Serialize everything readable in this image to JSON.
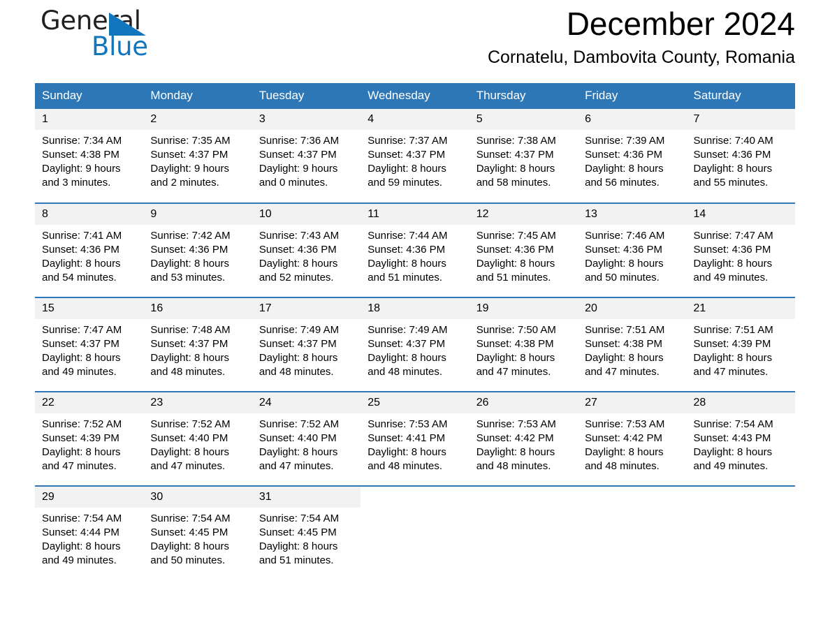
{
  "brand": {
    "word_one": "General",
    "word_two": "Blue",
    "triangle_color": "#1276bd",
    "text_color": "#231f20"
  },
  "header": {
    "title": "December 2024",
    "subtitle": "Cornatelu, Dambovita County, Romania"
  },
  "theme": {
    "header_bg": "#2e77b6",
    "header_text": "#ffffff",
    "daynum_bg": "#f2f2f2",
    "cell_bg": "#ffffff",
    "row_divider": "#2e77b6"
  },
  "weekday_headers": [
    "Sunday",
    "Monday",
    "Tuesday",
    "Wednesday",
    "Thursday",
    "Friday",
    "Saturday"
  ],
  "weeks": [
    [
      {
        "day": "1",
        "sunrise": "Sunrise: 7:34 AM",
        "sunset": "Sunset: 4:38 PM",
        "daylight1": "Daylight: 9 hours",
        "daylight2": "and 3 minutes."
      },
      {
        "day": "2",
        "sunrise": "Sunrise: 7:35 AM",
        "sunset": "Sunset: 4:37 PM",
        "daylight1": "Daylight: 9 hours",
        "daylight2": "and 2 minutes."
      },
      {
        "day": "3",
        "sunrise": "Sunrise: 7:36 AM",
        "sunset": "Sunset: 4:37 PM",
        "daylight1": "Daylight: 9 hours",
        "daylight2": "and 0 minutes."
      },
      {
        "day": "4",
        "sunrise": "Sunrise: 7:37 AM",
        "sunset": "Sunset: 4:37 PM",
        "daylight1": "Daylight: 8 hours",
        "daylight2": "and 59 minutes."
      },
      {
        "day": "5",
        "sunrise": "Sunrise: 7:38 AM",
        "sunset": "Sunset: 4:37 PM",
        "daylight1": "Daylight: 8 hours",
        "daylight2": "and 58 minutes."
      },
      {
        "day": "6",
        "sunrise": "Sunrise: 7:39 AM",
        "sunset": "Sunset: 4:36 PM",
        "daylight1": "Daylight: 8 hours",
        "daylight2": "and 56 minutes."
      },
      {
        "day": "7",
        "sunrise": "Sunrise: 7:40 AM",
        "sunset": "Sunset: 4:36 PM",
        "daylight1": "Daylight: 8 hours",
        "daylight2": "and 55 minutes."
      }
    ],
    [
      {
        "day": "8",
        "sunrise": "Sunrise: 7:41 AM",
        "sunset": "Sunset: 4:36 PM",
        "daylight1": "Daylight: 8 hours",
        "daylight2": "and 54 minutes."
      },
      {
        "day": "9",
        "sunrise": "Sunrise: 7:42 AM",
        "sunset": "Sunset: 4:36 PM",
        "daylight1": "Daylight: 8 hours",
        "daylight2": "and 53 minutes."
      },
      {
        "day": "10",
        "sunrise": "Sunrise: 7:43 AM",
        "sunset": "Sunset: 4:36 PM",
        "daylight1": "Daylight: 8 hours",
        "daylight2": "and 52 minutes."
      },
      {
        "day": "11",
        "sunrise": "Sunrise: 7:44 AM",
        "sunset": "Sunset: 4:36 PM",
        "daylight1": "Daylight: 8 hours",
        "daylight2": "and 51 minutes."
      },
      {
        "day": "12",
        "sunrise": "Sunrise: 7:45 AM",
        "sunset": "Sunset: 4:36 PM",
        "daylight1": "Daylight: 8 hours",
        "daylight2": "and 51 minutes."
      },
      {
        "day": "13",
        "sunrise": "Sunrise: 7:46 AM",
        "sunset": "Sunset: 4:36 PM",
        "daylight1": "Daylight: 8 hours",
        "daylight2": "and 50 minutes."
      },
      {
        "day": "14",
        "sunrise": "Sunrise: 7:47 AM",
        "sunset": "Sunset: 4:36 PM",
        "daylight1": "Daylight: 8 hours",
        "daylight2": "and 49 minutes."
      }
    ],
    [
      {
        "day": "15",
        "sunrise": "Sunrise: 7:47 AM",
        "sunset": "Sunset: 4:37 PM",
        "daylight1": "Daylight: 8 hours",
        "daylight2": "and 49 minutes."
      },
      {
        "day": "16",
        "sunrise": "Sunrise: 7:48 AM",
        "sunset": "Sunset: 4:37 PM",
        "daylight1": "Daylight: 8 hours",
        "daylight2": "and 48 minutes."
      },
      {
        "day": "17",
        "sunrise": "Sunrise: 7:49 AM",
        "sunset": "Sunset: 4:37 PM",
        "daylight1": "Daylight: 8 hours",
        "daylight2": "and 48 minutes."
      },
      {
        "day": "18",
        "sunrise": "Sunrise: 7:49 AM",
        "sunset": "Sunset: 4:37 PM",
        "daylight1": "Daylight: 8 hours",
        "daylight2": "and 48 minutes."
      },
      {
        "day": "19",
        "sunrise": "Sunrise: 7:50 AM",
        "sunset": "Sunset: 4:38 PM",
        "daylight1": "Daylight: 8 hours",
        "daylight2": "and 47 minutes."
      },
      {
        "day": "20",
        "sunrise": "Sunrise: 7:51 AM",
        "sunset": "Sunset: 4:38 PM",
        "daylight1": "Daylight: 8 hours",
        "daylight2": "and 47 minutes."
      },
      {
        "day": "21",
        "sunrise": "Sunrise: 7:51 AM",
        "sunset": "Sunset: 4:39 PM",
        "daylight1": "Daylight: 8 hours",
        "daylight2": "and 47 minutes."
      }
    ],
    [
      {
        "day": "22",
        "sunrise": "Sunrise: 7:52 AM",
        "sunset": "Sunset: 4:39 PM",
        "daylight1": "Daylight: 8 hours",
        "daylight2": "and 47 minutes."
      },
      {
        "day": "23",
        "sunrise": "Sunrise: 7:52 AM",
        "sunset": "Sunset: 4:40 PM",
        "daylight1": "Daylight: 8 hours",
        "daylight2": "and 47 minutes."
      },
      {
        "day": "24",
        "sunrise": "Sunrise: 7:52 AM",
        "sunset": "Sunset: 4:40 PM",
        "daylight1": "Daylight: 8 hours",
        "daylight2": "and 47 minutes."
      },
      {
        "day": "25",
        "sunrise": "Sunrise: 7:53 AM",
        "sunset": "Sunset: 4:41 PM",
        "daylight1": "Daylight: 8 hours",
        "daylight2": "and 48 minutes."
      },
      {
        "day": "26",
        "sunrise": "Sunrise: 7:53 AM",
        "sunset": "Sunset: 4:42 PM",
        "daylight1": "Daylight: 8 hours",
        "daylight2": "and 48 minutes."
      },
      {
        "day": "27",
        "sunrise": "Sunrise: 7:53 AM",
        "sunset": "Sunset: 4:42 PM",
        "daylight1": "Daylight: 8 hours",
        "daylight2": "and 48 minutes."
      },
      {
        "day": "28",
        "sunrise": "Sunrise: 7:54 AM",
        "sunset": "Sunset: 4:43 PM",
        "daylight1": "Daylight: 8 hours",
        "daylight2": "and 49 minutes."
      }
    ],
    [
      {
        "day": "29",
        "sunrise": "Sunrise: 7:54 AM",
        "sunset": "Sunset: 4:44 PM",
        "daylight1": "Daylight: 8 hours",
        "daylight2": "and 49 minutes."
      },
      {
        "day": "30",
        "sunrise": "Sunrise: 7:54 AM",
        "sunset": "Sunset: 4:45 PM",
        "daylight1": "Daylight: 8 hours",
        "daylight2": "and 50 minutes."
      },
      {
        "day": "31",
        "sunrise": "Sunrise: 7:54 AM",
        "sunset": "Sunset: 4:45 PM",
        "daylight1": "Daylight: 8 hours",
        "daylight2": "and 51 minutes."
      },
      {
        "day": "",
        "sunrise": "",
        "sunset": "",
        "daylight1": "",
        "daylight2": ""
      },
      {
        "day": "",
        "sunrise": "",
        "sunset": "",
        "daylight1": "",
        "daylight2": ""
      },
      {
        "day": "",
        "sunrise": "",
        "sunset": "",
        "daylight1": "",
        "daylight2": ""
      },
      {
        "day": "",
        "sunrise": "",
        "sunset": "",
        "daylight1": "",
        "daylight2": ""
      }
    ]
  ]
}
